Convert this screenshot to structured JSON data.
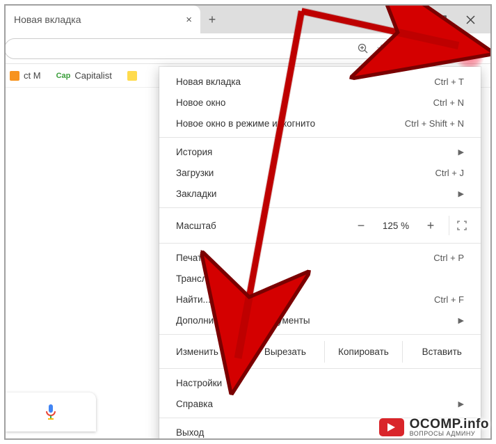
{
  "tab": {
    "title": "Новая вкладка"
  },
  "bookmarks": {
    "item_m": "ct M",
    "item_cap_badge": "Cap",
    "item_cap": "Capitalist"
  },
  "menu": {
    "new_tab": {
      "label": "Новая вкладка",
      "shortcut": "Ctrl + T"
    },
    "new_window": {
      "label": "Новое окно",
      "shortcut": "Ctrl + N"
    },
    "incognito": {
      "label": "Новое окно в режиме инкогнито",
      "shortcut": "Ctrl + Shift + N"
    },
    "history": {
      "label": "История"
    },
    "downloads": {
      "label": "Загрузки",
      "shortcut": "Ctrl + J"
    },
    "bookmarks": {
      "label": "Закладки"
    },
    "zoom": {
      "label": "Масштаб",
      "value": "125 %"
    },
    "print": {
      "label": "Печать...",
      "shortcut": "Ctrl + P"
    },
    "cast": {
      "label": "Трансляция..."
    },
    "find": {
      "label": "Найти...",
      "shortcut": "Ctrl + F"
    },
    "more_tools": {
      "label": "Дополнительные инструменты"
    },
    "edit": {
      "label": "Изменить",
      "cut": "Вырезать",
      "copy": "Копировать",
      "paste": "Вставить"
    },
    "settings": {
      "label": "Настройки"
    },
    "help": {
      "label": "Справка"
    },
    "exit": {
      "label": "Выход"
    }
  },
  "watermark": {
    "main": "OCOMP.info",
    "sub": "ВОПРОСЫ АДМИНУ"
  }
}
